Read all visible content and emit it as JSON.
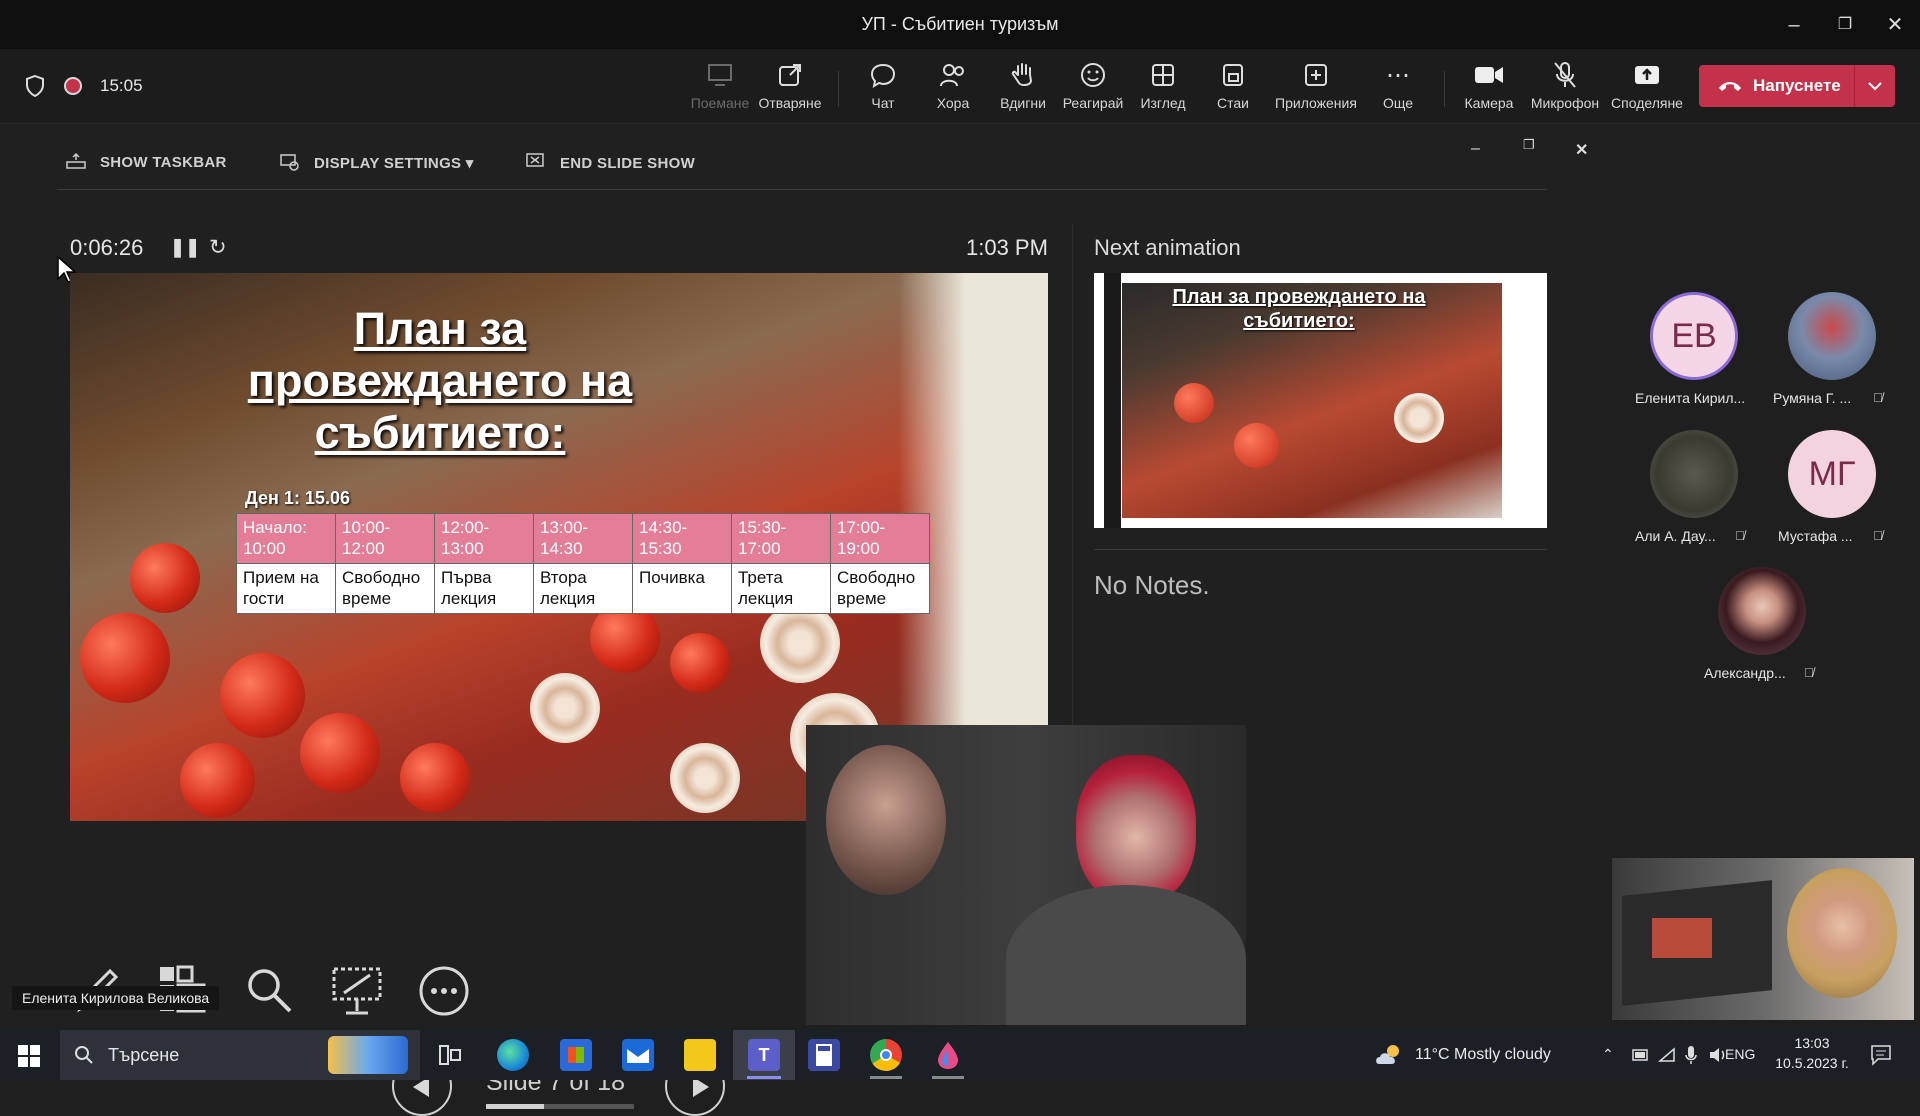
{
  "window": {
    "title": "УП - Събитиен туризъм"
  },
  "meeting": {
    "shield_icon": "shield-icon",
    "recording_indicator": "record-dot",
    "elapsed": "15:05",
    "toolbar": [
      {
        "label": "Поемане",
        "icon": "take-control-icon",
        "disabled": true
      },
      {
        "label": "Отваряне",
        "icon": "popout-icon",
        "disabled": false
      },
      {
        "label": "Чат",
        "icon": "chat-icon",
        "disabled": false
      },
      {
        "label": "Хора",
        "icon": "people-icon",
        "disabled": false
      },
      {
        "label": "Вдигни",
        "icon": "raise-hand-icon",
        "disabled": false
      },
      {
        "label": "Реагирай",
        "icon": "smile-icon",
        "disabled": false
      },
      {
        "label": "Изглед",
        "icon": "grid-icon",
        "disabled": false
      },
      {
        "label": "Стаи",
        "icon": "rooms-icon",
        "disabled": false
      },
      {
        "label": "Приложения",
        "icon": "add-apps-icon",
        "disabled": false
      },
      {
        "label": "Още",
        "icon": "more-icon",
        "disabled": false
      },
      {
        "label": "Камера",
        "icon": "camera-icon",
        "disabled": false
      },
      {
        "label": "Микрофон",
        "icon": "mic-off-icon",
        "disabled": false
      },
      {
        "label": "Споделяне",
        "icon": "share-icon",
        "disabled": false
      }
    ],
    "leave_label": "Напуснете",
    "leave_color": "#c4314b"
  },
  "presenter": {
    "tools": {
      "show_taskbar": "SHOW TASKBAR",
      "display_settings": "DISPLAY SETTINGS ▾",
      "end_slide_show": "END SLIDE SHOW"
    },
    "timer": "0:06:26",
    "clock": "1:03 PM",
    "next_animation_label": "Next animation",
    "notes": "No Notes.",
    "slide_counter": "Slide 7 of 18",
    "progress": 0.39,
    "slide": {
      "title": "План за провеждането на събитието:",
      "day_label": "Ден 1: 15.06",
      "header_row": [
        "Начало: 10:00",
        "10:00-12:00",
        "12:00-13:00",
        "13:00-14:30",
        "14:30-15:30",
        "15:30-17:00",
        "17:00-19:00"
      ],
      "body_row": [
        "Прием на гости",
        "Свободно време",
        "Първа лекция",
        "Втора лекция",
        "Почивка",
        "Трета лекция",
        "Свободно време"
      ],
      "header_color": "#e47d97"
    },
    "next_slide_title": "План за провеждането на събитието:"
  },
  "participants": [
    {
      "initials": "ЕВ",
      "name": "Еленита Кирил...",
      "avatar_color": "#f4d6e6",
      "muted": false
    },
    {
      "initials": "",
      "name": "Румяна Г. ...",
      "avatar_color": "#5a6b8a",
      "muted": true
    },
    {
      "initials": "",
      "name": "Али А. Дау...",
      "avatar_color": "#4a4a40",
      "muted": true
    },
    {
      "initials": "МГ",
      "name": "Мустафа ...",
      "avatar_color": "#f2d3df",
      "muted": true
    },
    {
      "initials": "",
      "name": "Александр...",
      "avatar_color": "#6a4a55",
      "muted": true
    }
  ],
  "speaker_tooltip": "Еленита Кирилова Великова",
  "taskbar": {
    "search_placeholder": "Търсене",
    "weather": "11°C  Mostly cloudy",
    "lang": "ENG",
    "time": "13:03",
    "date": "10.5.2023 г."
  }
}
